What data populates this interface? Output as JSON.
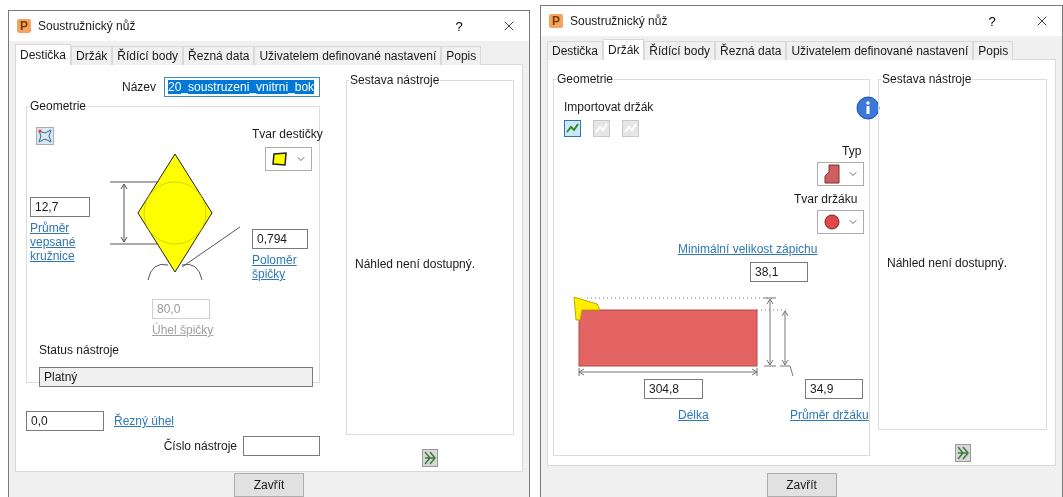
{
  "dialogs": [
    {
      "kind": "insert",
      "app_icon_letter": "P",
      "title": "Soustružnický nůž",
      "help_button": "?",
      "tabs": [
        {
          "label": "Destička",
          "selected": true
        },
        {
          "label": "Držák",
          "selected": false
        },
        {
          "label": "Řídící body",
          "selected": false
        },
        {
          "label": "Řezná data",
          "selected": false
        },
        {
          "label": "Uživatelem definované nastavení",
          "selected": false
        },
        {
          "label": "Popis",
          "selected": false
        }
      ],
      "name_field": {
        "label": "Název",
        "value": "20_soustruzeni_vnitrni_bok",
        "text_selected": true
      },
      "geometry": {
        "title": "Geometrie",
        "shape_label": "Tvar destičky",
        "inscribed_diameter": {
          "value": "12,7",
          "label": "Průměr vepsané kružnice"
        },
        "nose_radius": {
          "value": "0,794",
          "label": "Poloměr špičky"
        },
        "nose_angle": {
          "value": "80,0",
          "label": "Úhel špičky",
          "disabled": true
        },
        "status_label": "Status nástroje",
        "status_value": "Platný"
      },
      "cutting_angle": {
        "value": "0,0",
        "label": "Řezný úhel"
      },
      "tool_number": {
        "label": "Číslo nástroje"
      },
      "assembly": {
        "title": "Sestava nástroje",
        "message": "Náhled není dostupný."
      },
      "close_button": "Zavřít"
    },
    {
      "kind": "holder",
      "app_icon_letter": "P",
      "title": "Soustružnický nůž",
      "help_button": "?",
      "tabs": [
        {
          "label": "Destička",
          "selected": false
        },
        {
          "label": "Držák",
          "selected": true
        },
        {
          "label": "Řídící body",
          "selected": false
        },
        {
          "label": "Řezná data",
          "selected": false
        },
        {
          "label": "Uživatelem definované nastavení",
          "selected": false
        },
        {
          "label": "Popis",
          "selected": false
        }
      ],
      "geometry": {
        "title": "Geometrie",
        "import_label": "Importovat držák",
        "import_tools": [
          {
            "disabled": false
          },
          {
            "disabled": true
          },
          {
            "disabled": true
          }
        ],
        "type_label": "Typ",
        "shape_label": "Tvar držáku",
        "min_groove": {
          "label": "Minimální velikost zápichu",
          "value": "38,1"
        },
        "length": {
          "value": "304,8",
          "label": "Délka"
        },
        "diameter": {
          "value": "34,9",
          "label": "Průměr držáku"
        }
      },
      "assembly": {
        "title": "Sestava nástroje",
        "message": "Náhled není dostupný."
      },
      "close_button": "Zavřít"
    }
  ]
}
